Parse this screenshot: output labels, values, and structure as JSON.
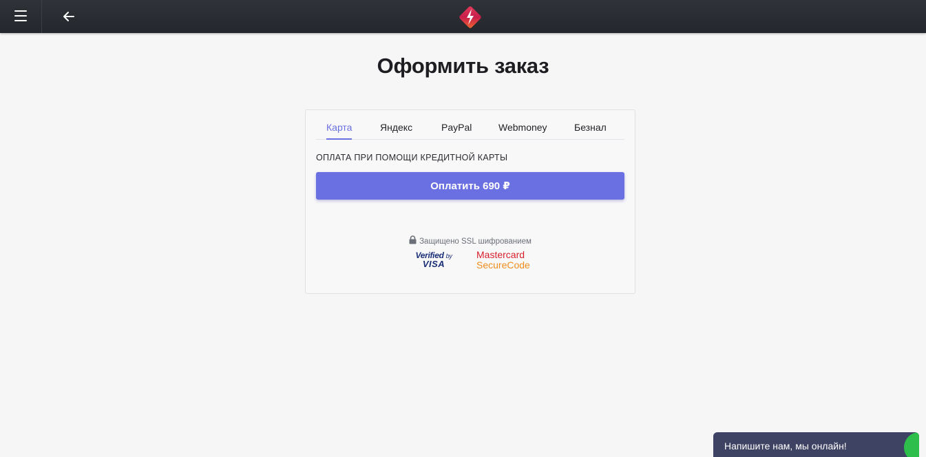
{
  "header": {
    "menu_icon": "hamburger-icon",
    "back_icon": "arrow-left-icon",
    "logo_icon": "lightning-diamond-logo",
    "background": "#2b2f34"
  },
  "page": {
    "title": "Оформить заказ"
  },
  "payment": {
    "tabs": [
      {
        "label": "Карта",
        "active": true
      },
      {
        "label": "Яндекс",
        "active": false
      },
      {
        "label": "PayPal",
        "active": false
      },
      {
        "label": "Webmoney",
        "active": false
      },
      {
        "label": "Безнал",
        "active": false
      }
    ],
    "heading": "ОПЛАТА ПРИ ПОМОЩИ КРЕДИТНОЙ КАРТЫ",
    "pay_button_label": "Оплатить 690 ₽",
    "ssl_text": "Защищено SSL шифрованием",
    "visa_line1": "Verified",
    "visa_by": "by",
    "visa_line2": "VISA",
    "mastercard_line1": "Mastercard",
    "mastercard_line2": "SecureCode",
    "accent_color": "#6a6fe1"
  },
  "chat": {
    "label": "Напишите нам, мы онлайн!",
    "status_color": "#2dbe4c"
  }
}
